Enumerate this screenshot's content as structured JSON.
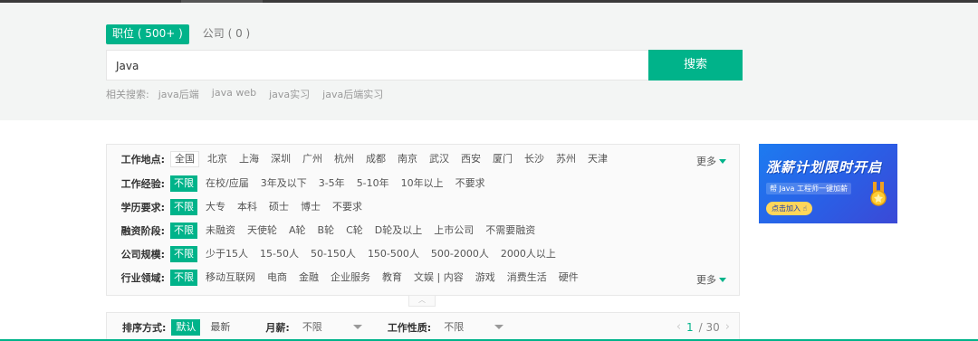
{
  "search": {
    "tabs": [
      {
        "label": "职位 ( 500+ )",
        "active": true
      },
      {
        "label": "公司 ( 0 )",
        "active": false
      }
    ],
    "query": "Java",
    "button_label": "搜索",
    "related_label": "相关搜索:",
    "related": [
      "java后端",
      "java web",
      "java实习",
      "java后端实习"
    ]
  },
  "filters": {
    "rows": [
      {
        "label": "工作地点:",
        "options": [
          "全国",
          "北京",
          "上海",
          "深圳",
          "广州",
          "杭州",
          "成都",
          "南京",
          "武汉",
          "西安",
          "厦门",
          "长沙",
          "苏州",
          "天津"
        ],
        "selected": 0,
        "more": "更多"
      },
      {
        "label": "工作经验:",
        "options": [
          "不限",
          "在校/应届",
          "3年及以下",
          "3-5年",
          "5-10年",
          "10年以上",
          "不要求"
        ],
        "selected": 0
      },
      {
        "label": "学历要求:",
        "options": [
          "不限",
          "大专",
          "本科",
          "硕士",
          "博士",
          "不要求"
        ],
        "selected": 0
      },
      {
        "label": "融资阶段:",
        "options": [
          "不限",
          "未融资",
          "天使轮",
          "A轮",
          "B轮",
          "C轮",
          "D轮及以上",
          "上市公司",
          "不需要融资"
        ],
        "selected": 0
      },
      {
        "label": "公司规模:",
        "options": [
          "不限",
          "少于15人",
          "15-50人",
          "50-150人",
          "150-500人",
          "500-2000人",
          "2000人以上"
        ],
        "selected": 0
      },
      {
        "label": "行业领域:",
        "options": [
          "不限",
          "移动互联网",
          "电商",
          "金融",
          "企业服务",
          "教育",
          "文娱 | 内容",
          "游戏",
          "消费生活",
          "硬件"
        ],
        "selected": 0,
        "more": "更多"
      }
    ]
  },
  "sort_bar": {
    "label": "排序方式:",
    "options": [
      "默认",
      "最新"
    ],
    "salary_label": "月薪:",
    "salary_value": "不限",
    "nature_label": "工作性质:",
    "nature_value": "不限",
    "page_current": "1",
    "page_total": "/ 30"
  },
  "ad": {
    "title": "涨薪计划限时开启",
    "subtitle": "帮 Java 工程师一键加薪",
    "button": "点击加入 ☝"
  },
  "colors": {
    "accent": "#00b38a"
  },
  "icons": [
    "caret-down-icon",
    "collapse-up-icon",
    "chevron-left-icon",
    "chevron-right-icon",
    "medal-icon"
  ]
}
